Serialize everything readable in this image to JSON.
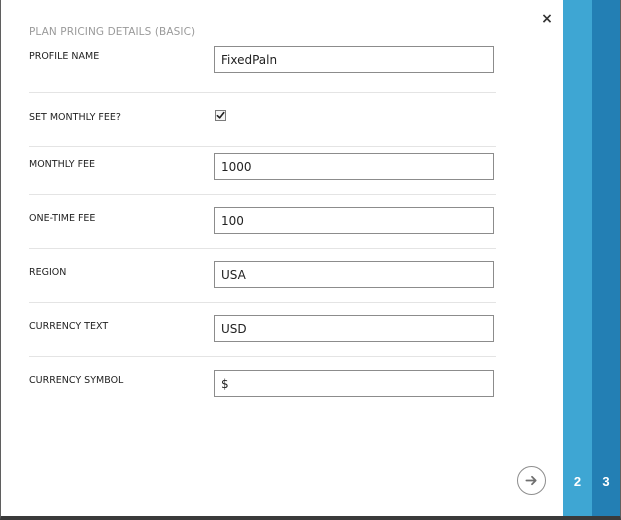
{
  "dialog": {
    "title": "PLAN PRICING DETAILS (BASIC)",
    "close_symbol": "×",
    "fields": [
      {
        "label": "PROFILE NAME",
        "type": "text",
        "value": "FixedPaln"
      },
      {
        "label": "SET MONTHLY FEE?",
        "type": "checkbox",
        "checked": true
      },
      {
        "label": "MONTHLY FEE",
        "type": "text",
        "value": "1000"
      },
      {
        "label": "ONE-TIME FEE",
        "type": "text",
        "value": "100"
      },
      {
        "label": "REGION",
        "type": "text",
        "value": "USA"
      },
      {
        "label": "CURRENCY TEXT",
        "type": "text",
        "value": "USD"
      },
      {
        "label": "CURRENCY SYMBOL",
        "type": "text",
        "value": "$"
      }
    ],
    "next_icon": "arrow-right-circle-icon"
  },
  "steps": [
    {
      "label": "2",
      "color": "#3ea6d3"
    },
    {
      "label": "3",
      "color": "#237fb4"
    }
  ],
  "colors": {
    "accent_light": "#3ea6d3",
    "accent_dark": "#237fb4"
  }
}
